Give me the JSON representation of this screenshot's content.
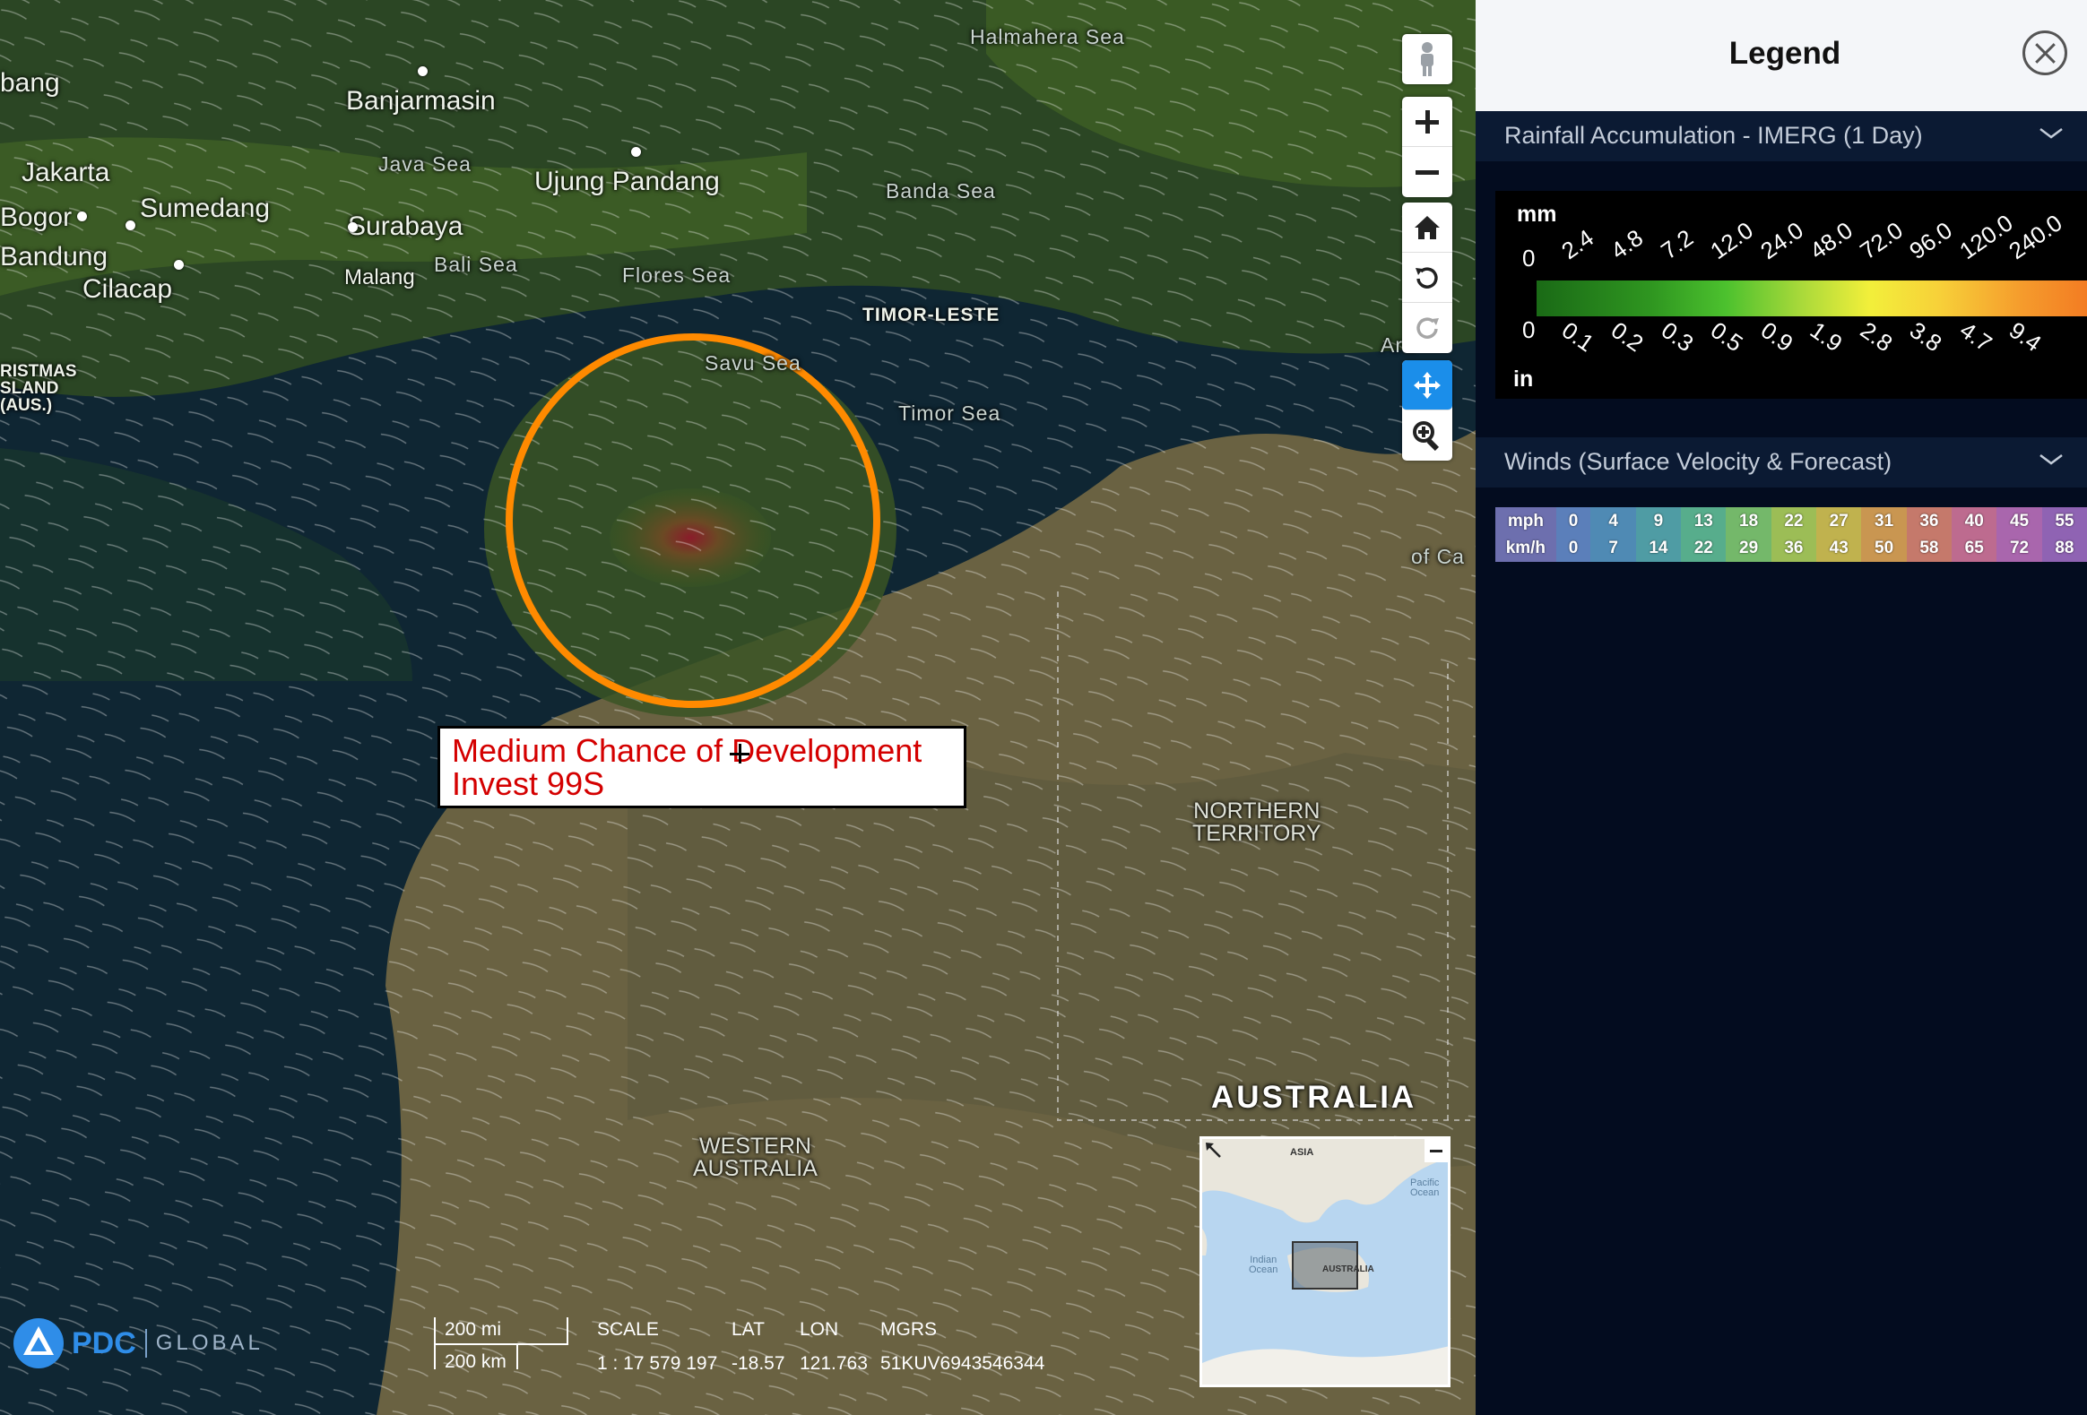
{
  "map": {
    "places": {
      "bang": "bang",
      "jakarta": "Jakarta",
      "bogor": "Bogor",
      "bandung": "Bandung",
      "sumedang": "Sumedang",
      "cilacap": "Cilacap",
      "banjarmasin": "Banjarmasin",
      "surabaya": "Surabaya",
      "malang": "Malang",
      "ujung_pandang": "Ujung Pandang",
      "christmas_island": "RISTMAS\nSLAND\n(AUS.)",
      "timor_leste": "TIMOR-LESTE",
      "northern_territory": "NORTHERN\nTERRITORY",
      "western_australia": "WESTERN\nAUSTRALIA",
      "australia": "AUSTRALIA"
    },
    "seas": {
      "halmahera": "Halmahera Sea",
      "java": "Java Sea",
      "banda": "Banda Sea",
      "bali": "Bali Sea",
      "flores": "Flores Sea",
      "savu": "Savu Sea",
      "timor": "Timor Sea",
      "arafura": "Ara",
      "gulf": "of Ca"
    },
    "annotation": {
      "line1": "Medium Chance of Development",
      "line2": "Invest 99S",
      "circle_color": "#ff8a00"
    },
    "toolbar": {
      "street_view": "person-icon",
      "zoom_in": "plus-icon",
      "zoom_out": "minus-icon",
      "home": "home-icon",
      "rotate_ccw": "rotate-left-icon",
      "rotate_cw": "rotate-right-icon",
      "pan": "move-icon",
      "zoom_box": "zoom-search-icon"
    },
    "logo": {
      "brand": "PDC",
      "product": "GLOBAL"
    },
    "scale": {
      "mi": "200 mi",
      "km": "200 km"
    },
    "status": {
      "scale_label": "SCALE",
      "scale_value": "1 : 17 579 197",
      "lat_label": "LAT",
      "lat_value": "-18.57",
      "lon_label": "LON",
      "lon_value": "121.763",
      "mgrs_label": "MGRS",
      "mgrs_value": "51KUV6943546344"
    },
    "minimap": {
      "asia": "ASIA",
      "pacific": "Pacific\nOcean",
      "indian": "Indian\nOcean",
      "australia": "AUSTRALIA"
    }
  },
  "legend": {
    "title": "Legend",
    "rainfall": {
      "title": "Rainfall Accumulation - IMERG (1 Day)",
      "unit_mm": "mm",
      "unit_in": "in",
      "mm_ticks": [
        "0",
        "2.4",
        "4.8",
        "7.2",
        "12.0",
        "24.0",
        "48.0",
        "72.0",
        "96.0",
        "120.0",
        "240.0"
      ],
      "in_ticks": [
        "0",
        "0.1",
        "0.2",
        "0.3",
        "0.5",
        "0.9",
        "1.9",
        "2.8",
        "3.8",
        "4.7",
        "9.4"
      ]
    },
    "winds": {
      "title": "Winds (Surface Velocity & Forecast)",
      "row_labels": [
        "mph",
        "km/h"
      ],
      "mph": [
        "0",
        "4",
        "9",
        "13",
        "18",
        "22",
        "27",
        "31",
        "36",
        "40",
        "45",
        "55"
      ],
      "kmh": [
        "0",
        "7",
        "14",
        "22",
        "29",
        "36",
        "43",
        "50",
        "58",
        "65",
        "72",
        "88"
      ],
      "colors": [
        "#6d6fae",
        "#5b7fba",
        "#4f8ab4",
        "#4f9ca4",
        "#57ad8c",
        "#74b86a",
        "#9cbd56",
        "#c0b24e",
        "#c99651",
        "#c5796b",
        "#bd6b8f",
        "#a966ad",
        "#8f63b3"
      ]
    }
  }
}
